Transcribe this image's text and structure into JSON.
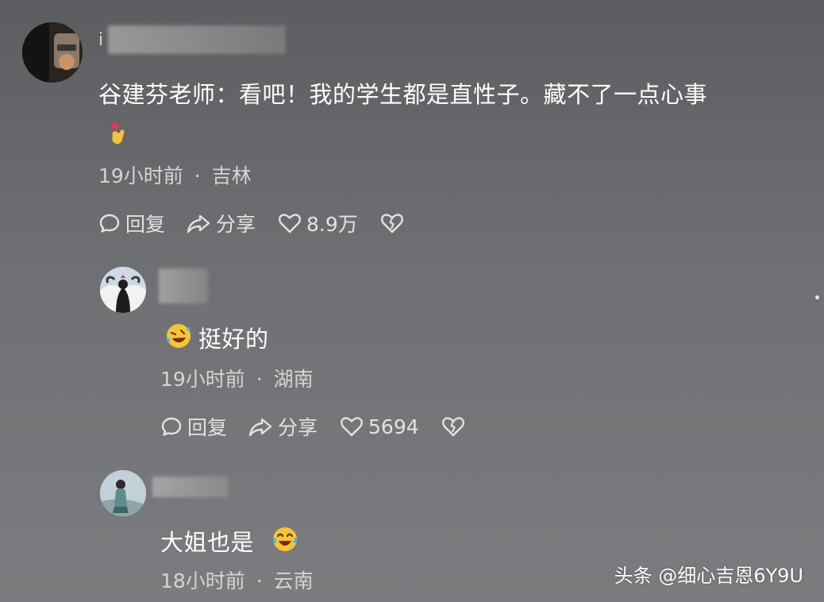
{
  "comments": [
    {
      "username_visible": "i",
      "text": "谷建芬老师：看吧！我的学生都是直性子。藏不了一点心事",
      "time": "19小时前",
      "sep": "·",
      "location": "吉林",
      "reply_label": "回复",
      "share_label": "分享",
      "likes": "8.9万"
    },
    {
      "text": "挺好的",
      "time": "19小时前",
      "sep": "·",
      "location": "湖南",
      "reply_label": "回复",
      "share_label": "分享",
      "likes": "5694"
    },
    {
      "text": "大姐也是",
      "time": "18小时前",
      "sep": "·",
      "location": "云南"
    }
  ],
  "watermark": "头条 @细心吉恩6Y9U",
  "icons": {
    "reply": "comment-bubble-icon",
    "share": "share-arrow-icon",
    "like": "heart-icon",
    "dislike": "broken-heart-icon"
  }
}
